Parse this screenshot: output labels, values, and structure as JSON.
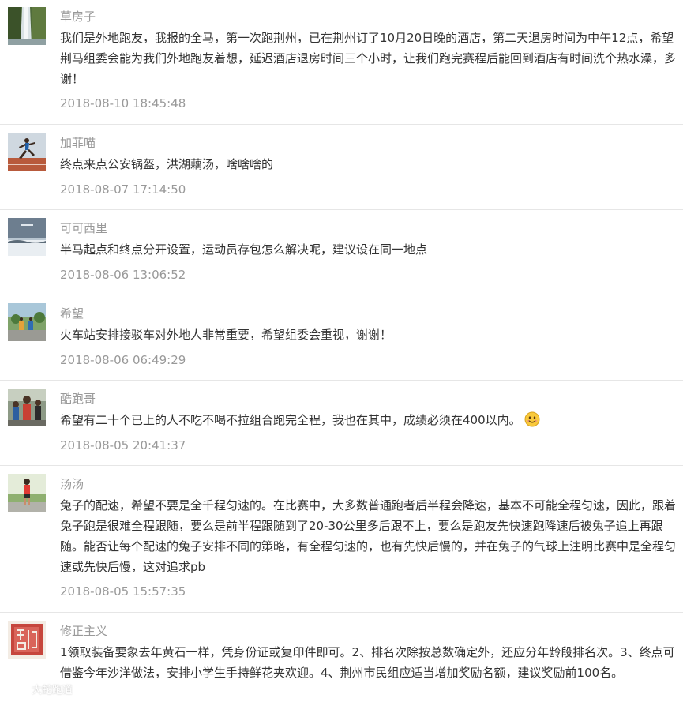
{
  "comments": [
    {
      "username": "草房子",
      "text": "我们是外地跑友，我报的全马，第一次跑荆州，已在荆州订了10月20日晚的酒店，第二天退房时间为中午12点，希望荆马组委会能为我们外地跑友着想，延迟酒店退房时间三个小时，让我们跑完赛程后能回到酒店有时间洗个热水澡，多谢！",
      "time": "2018-08-10 18:45:48",
      "avatar": "waterfall-avatar"
    },
    {
      "username": "加菲喵",
      "text": "终点来点公安锅盔，洪湖藕汤，啥啥啥的",
      "time": "2018-08-07 17:14:50",
      "avatar": "runner-track-avatar"
    },
    {
      "username": "可可西里",
      "text": "半马起点和终点分开设置，运动员存包怎么解决呢，建议设在同一地点",
      "time": "2018-08-06 13:06:52",
      "avatar": "snow-landscape-avatar"
    },
    {
      "username": "希望",
      "text": "火车站安排接驳车对外地人非常重要，希望组委会重视，谢谢！",
      "time": "2018-08-06 06:49:29",
      "avatar": "street-runners-avatar"
    },
    {
      "username": "酷跑哥",
      "text": "希望有二十个已上的人不吃不喝不拉组合跑完全程，我也在其中，成绩必须在400以内。",
      "time": "2018-08-05 20:41:37",
      "avatar": "group-runners-avatar",
      "emoji": "smile-emoji"
    },
    {
      "username": "汤汤",
      "text": "兔子的配速，希望不要是全千程匀速的。在比赛中，大多数普通跑者后半程会降速，基本不可能全程匀速，因此，跟着兔子跑是很难全程跟随，要么是前半程跟随到了20-30公里多后跟不上，要么是跑友先快速跑降速后被兔子追上再跟随。能否让每个配速的兔子安排不同的策略，有全程匀速的，也有先快后慢的，并在兔子的气球上注明比赛中是全程匀速或先快后慢，这对追求pb",
      "time": "2018-08-05 15:57:35",
      "avatar": "marathon-runner-avatar"
    },
    {
      "username": "修正主义",
      "text": "1领取装备要象去年黄石一样，凭身份证或复印件即可。2、排名次除按总数确定外，还应分年龄段排名次。3、终点可借鉴今年沙洋做法，安排小学生手持鲜花夹欢迎。4、荆州市民组应适当增加奖励名额，建议奖励前100名。",
      "time": "",
      "avatar": "calligraphy-seal-avatar"
    }
  ],
  "watermark": {
    "text": "大蛇跑道"
  }
}
